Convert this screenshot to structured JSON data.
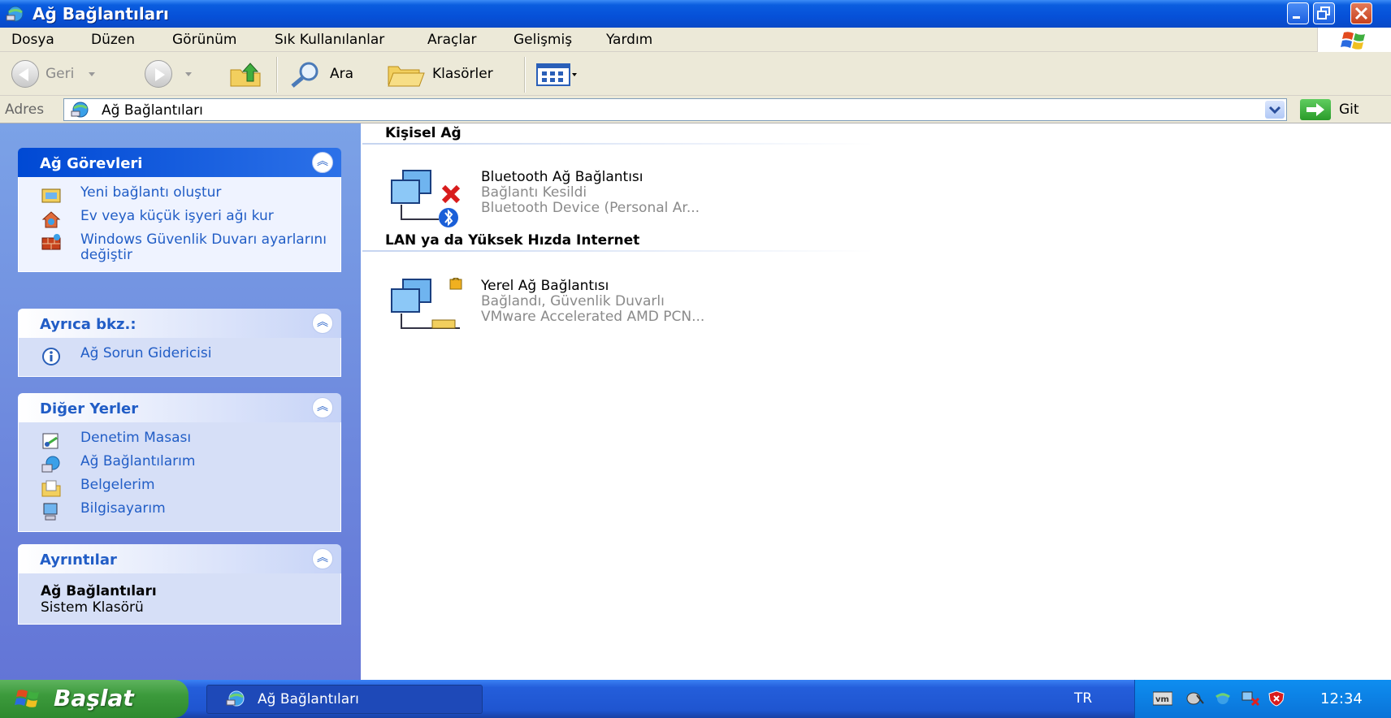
{
  "window": {
    "title": "Ağ Bağlantıları"
  },
  "menu": [
    "Dosya",
    "Düzen",
    "Görünüm",
    "Sık Kullanılanlar",
    "Araçlar",
    "Gelişmiş",
    "Yardım"
  ],
  "toolbar": {
    "back_label": "Geri",
    "search_label": "Ara",
    "folders_label": "Klasörler"
  },
  "address": {
    "label": "Adres",
    "value": "Ağ Bağlantıları",
    "go_label": "Git"
  },
  "taskpane": {
    "network_tasks": {
      "title": "Ağ Görevleri",
      "links": [
        "Yeni bağlantı oluştur",
        "Ev veya küçük işyeri ağı kur",
        "Windows Güvenlik Duvarı ayarlarını değiştir"
      ]
    },
    "see_also": {
      "title": "Ayrıca bkz.:",
      "links": [
        "Ağ Sorun Gidericisi"
      ]
    },
    "other_places": {
      "title": "Diğer Yerler",
      "links": [
        "Denetim Masası",
        "Ağ Bağlantılarım",
        "Belgelerim",
        "Bilgisayarım"
      ]
    },
    "details": {
      "title": "Ayrıntılar",
      "name": "Ağ Bağlantıları",
      "type": "Sistem Klasörü"
    }
  },
  "content": {
    "groups": [
      {
        "title": "Kişisel Ağ",
        "items": [
          {
            "name": "Bluetooth Ağ Bağlantısı",
            "status": "Bağlantı Kesildi",
            "device": "Bluetooth Device (Personal Ar..."
          }
        ]
      },
      {
        "title": "LAN ya da Yüksek Hızda Internet",
        "items": [
          {
            "name": "Yerel Ağ Bağlantısı",
            "status": "Bağlandı, Güvenlik Duvarlı",
            "device": "VMware Accelerated AMD PCN..."
          }
        ]
      }
    ]
  },
  "taskbar": {
    "start_label": "Başlat",
    "task_label": "Ağ Bağlantıları",
    "language": "TR",
    "clock": "12:34"
  },
  "colors": {
    "titlebar": "#0650d8",
    "taskpane": "#7ba2e7",
    "link": "#215dc6",
    "start": "#3c9a3c"
  }
}
